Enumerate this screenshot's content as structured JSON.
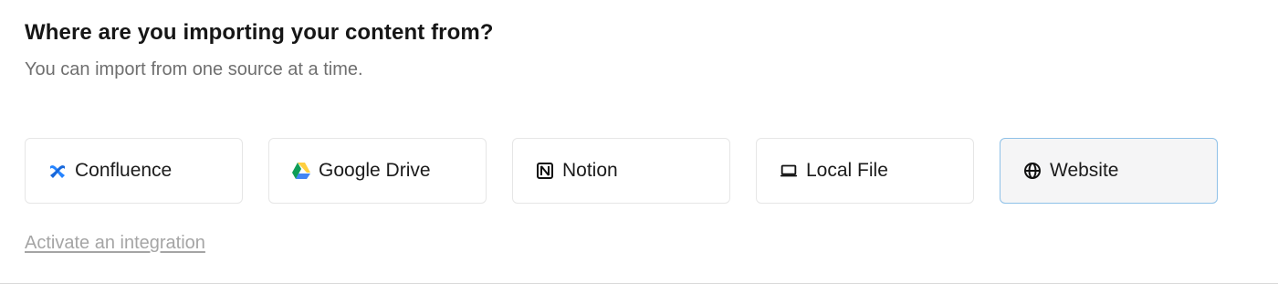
{
  "header": {
    "title": "Where are you importing your content from?",
    "subtitle": "You can import from one source at a time."
  },
  "sources": [
    {
      "label": "Confluence",
      "icon": "confluence-icon",
      "selected": false
    },
    {
      "label": "Google Drive",
      "icon": "google-drive-icon",
      "selected": false
    },
    {
      "label": "Notion",
      "icon": "notion-icon",
      "selected": false
    },
    {
      "label": "Local File",
      "icon": "laptop-icon",
      "selected": false
    },
    {
      "label": "Website",
      "icon": "globe-icon",
      "selected": true
    }
  ],
  "footer": {
    "activate_link": "Activate an integration"
  },
  "colors": {
    "confluence_blue": "#2684FF",
    "selected_border": "#8FC1E8",
    "selected_background": "#F5F5F6",
    "link_gray": "#A5A5A5"
  }
}
